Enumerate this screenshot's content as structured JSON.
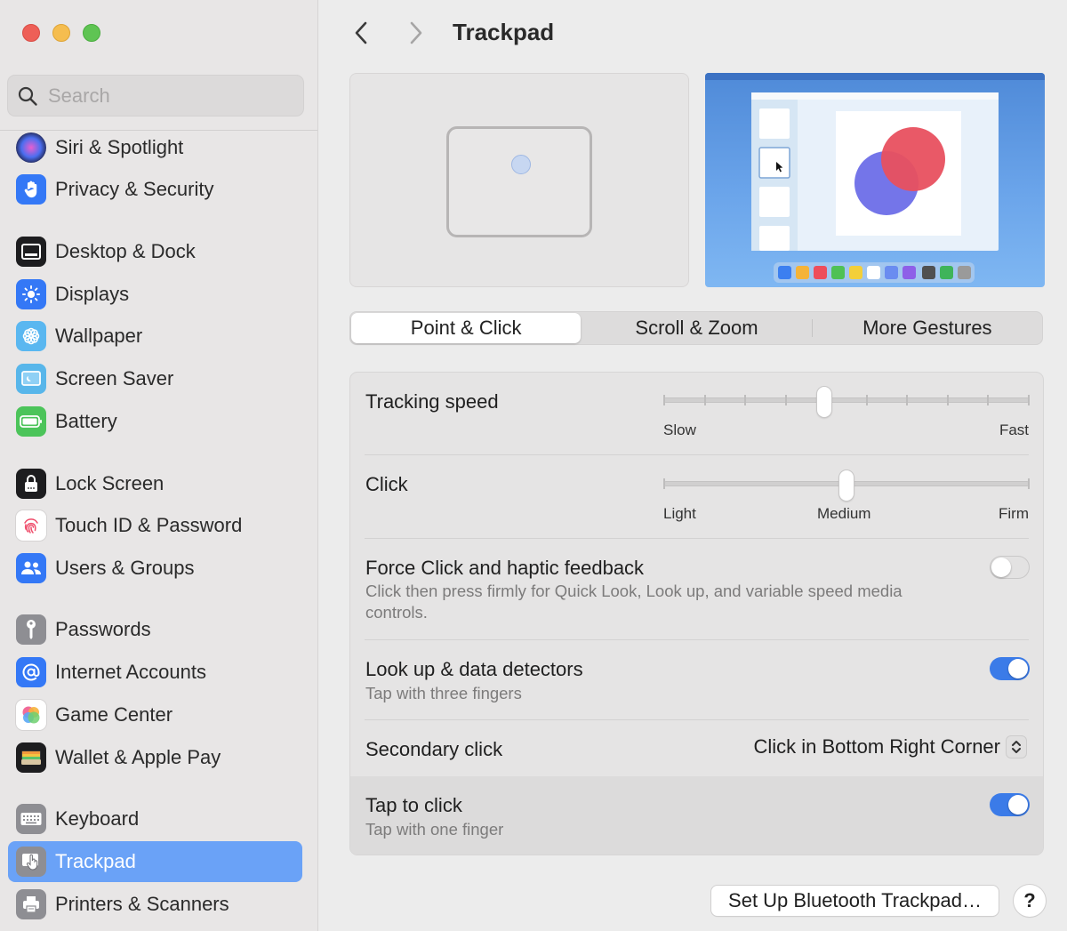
{
  "window": {
    "title": "Trackpad"
  },
  "sidebar": {
    "search_placeholder": "Search",
    "items": [
      {
        "label": "Siri & Spotlight",
        "icon": "siri-icon",
        "color": "#1c1c3a"
      },
      {
        "label": "Privacy & Security",
        "icon": "hand-icon",
        "color": "#3478f6"
      },
      {
        "label": "Desktop & Dock",
        "icon": "dock-icon",
        "color": "#1d1d1f"
      },
      {
        "label": "Displays",
        "icon": "sun-icon",
        "color": "#3478f6"
      },
      {
        "label": "Wallpaper",
        "icon": "flower-icon",
        "color": "#5ab7f0"
      },
      {
        "label": "Screen Saver",
        "icon": "screen-saver-icon",
        "color": "#58b6ea"
      },
      {
        "label": "Battery",
        "icon": "battery-icon",
        "color": "#4cc45a"
      },
      {
        "label": "Lock Screen",
        "icon": "lock-icon",
        "color": "#1d1d1f"
      },
      {
        "label": "Touch ID & Password",
        "icon": "fingerprint-icon",
        "color": "#ffffff"
      },
      {
        "label": "Users & Groups",
        "icon": "users-icon",
        "color": "#3478f6"
      },
      {
        "label": "Passwords",
        "icon": "key-icon",
        "color": "#8e8e93"
      },
      {
        "label": "Internet Accounts",
        "icon": "at-icon",
        "color": "#3478f6"
      },
      {
        "label": "Game Center",
        "icon": "game-center-icon",
        "color": "#ffffff"
      },
      {
        "label": "Wallet & Apple Pay",
        "icon": "wallet-icon",
        "color": "#1d1d1f"
      },
      {
        "label": "Keyboard",
        "icon": "keyboard-icon",
        "color": "#8e8e93"
      },
      {
        "label": "Trackpad",
        "icon": "trackpad-icon",
        "color": "#8e8e93",
        "active": true
      },
      {
        "label": "Printers & Scanners",
        "icon": "printer-icon",
        "color": "#8e8e93"
      }
    ]
  },
  "tabs": [
    {
      "label": "Point & Click",
      "active": true
    },
    {
      "label": "Scroll & Zoom",
      "active": false
    },
    {
      "label": "More Gestures",
      "active": false
    }
  ],
  "settings": {
    "tracking_speed": {
      "label": "Tracking speed",
      "min_label": "Slow",
      "max_label": "Fast",
      "value": 0.44
    },
    "click": {
      "label": "Click",
      "left_label": "Light",
      "mid_label": "Medium",
      "right_label": "Firm",
      "value": 0.5
    },
    "force_click": {
      "label": "Force Click and haptic feedback",
      "description": "Click then press firmly for Quick Look, Look up, and variable speed media controls.",
      "enabled": false
    },
    "look_up": {
      "label": "Look up & data detectors",
      "description": "Tap with three fingers",
      "enabled": true
    },
    "secondary_click": {
      "label": "Secondary click",
      "value": "Click in Bottom Right Corner"
    },
    "tap_to_click": {
      "label": "Tap to click",
      "description": "Tap with one finger",
      "enabled": true
    }
  },
  "footer": {
    "bluetooth_button": "Set Up Bluetooth Trackpad…",
    "help_button": "?"
  },
  "colors": {
    "accent": "#3b7be8",
    "sidebar_selection": "#6aa2f7"
  }
}
